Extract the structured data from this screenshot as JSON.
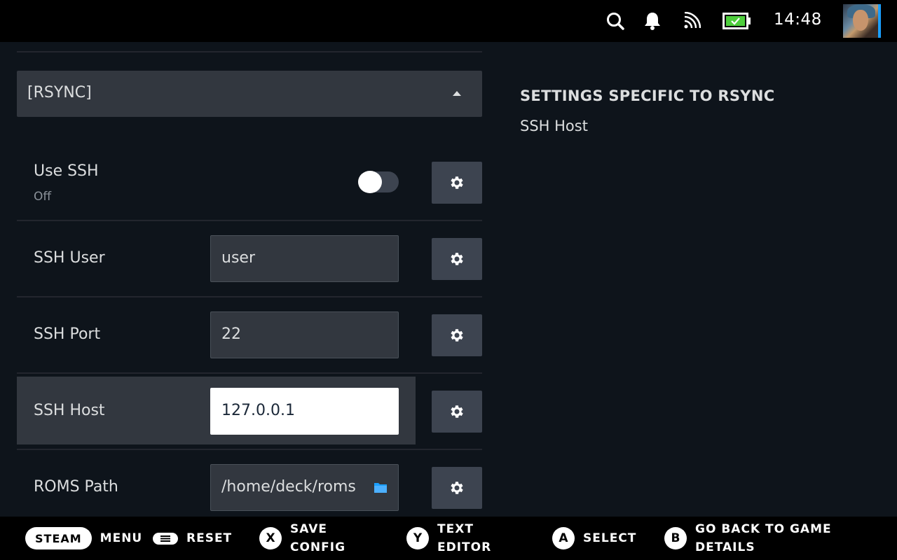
{
  "status_bar": {
    "clock": "14:48",
    "icons": [
      "search-icon",
      "notification-bell-icon",
      "cast-icon",
      "battery-charging-icon"
    ],
    "accent_color": "#1a9fff",
    "battery_color": "#4ece3c"
  },
  "dropdown": {
    "selected": "[RSYNC]"
  },
  "settings": {
    "use_ssh": {
      "label": "Use SSH",
      "state_text": "Off",
      "enabled": false
    },
    "ssh_user": {
      "label": "SSH User",
      "value": "user"
    },
    "ssh_port": {
      "label": "SSH Port",
      "value": "22"
    },
    "ssh_host": {
      "label": "SSH Host",
      "value": "127.0.0.1"
    },
    "roms_path": {
      "label": "ROMS Path",
      "value": "/home/deck/roms"
    }
  },
  "help_panel": {
    "title": "SETTINGS SPECIFIC TO RSYNC",
    "description": "SSH Host"
  },
  "bottom_bar": {
    "steam": {
      "button": "STEAM",
      "label": "MENU"
    },
    "menu": {
      "label": "RESET"
    },
    "x": {
      "button": "X",
      "label_line1": "SAVE",
      "label_line2": "CONFIG"
    },
    "y": {
      "button": "Y",
      "label_line1": "TEXT",
      "label_line2": "EDITOR"
    },
    "a": {
      "button": "A",
      "label": "SELECT"
    },
    "b": {
      "button": "B",
      "label_line1": "GO BACK TO GAME",
      "label_line2": "DETAILS"
    }
  }
}
